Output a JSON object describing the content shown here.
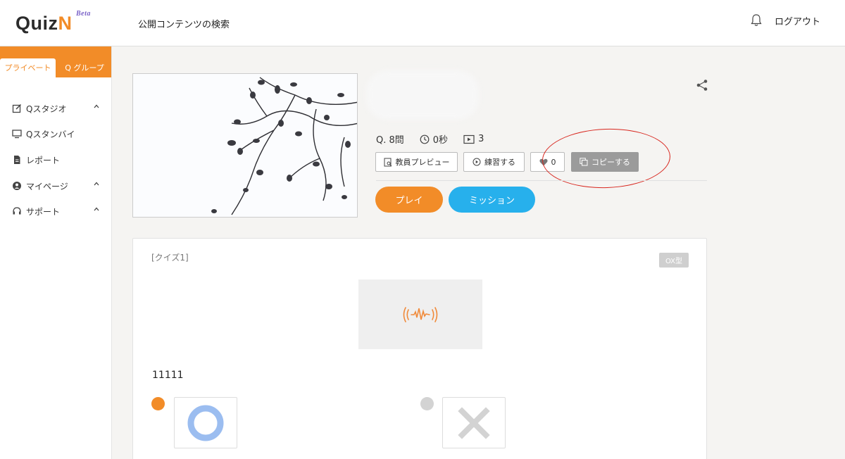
{
  "header": {
    "logo_text": "Quiz",
    "logo_letter": "N",
    "logo_badge": "Beta",
    "nav_search": "公開コンテンツの検索",
    "logout": "ログアウト"
  },
  "sidebar": {
    "tabs": [
      {
        "label": "プライベート",
        "active": true
      },
      {
        "label": "Q グループ",
        "active": false
      }
    ],
    "items": [
      {
        "label": "Qスタジオ",
        "icon": "edit-icon",
        "expandable": true
      },
      {
        "label": "Qスタンバイ",
        "icon": "monitor-icon",
        "expandable": false
      },
      {
        "label": "レポート",
        "icon": "document-icon",
        "expandable": false
      },
      {
        "label": "マイページ",
        "icon": "user-circle-icon",
        "expandable": true
      },
      {
        "label": "サポート",
        "icon": "headset-icon",
        "expandable": true
      }
    ]
  },
  "quiz": {
    "stats": {
      "questions": "Q. 8問",
      "time": "0秒",
      "plays": "3"
    },
    "buttons": {
      "teacher_preview": "教員プレビュー",
      "practice": "練習する",
      "likes": "0",
      "copy": "コピーする",
      "play": "プレイ",
      "mission": "ミッション"
    }
  },
  "card": {
    "quiz_label": "[クイズ1]",
    "type_badge": "OX型",
    "question_text": "11111",
    "choices": [
      {
        "symbol": "O",
        "selected": true
      },
      {
        "symbol": "X",
        "selected": false
      }
    ]
  },
  "colors": {
    "accent": "#f28c28",
    "mission": "#27b0ec",
    "circle_o": "#9bbdf0",
    "cross_x": "#d3d3d3",
    "annotation": "#d8261e"
  }
}
